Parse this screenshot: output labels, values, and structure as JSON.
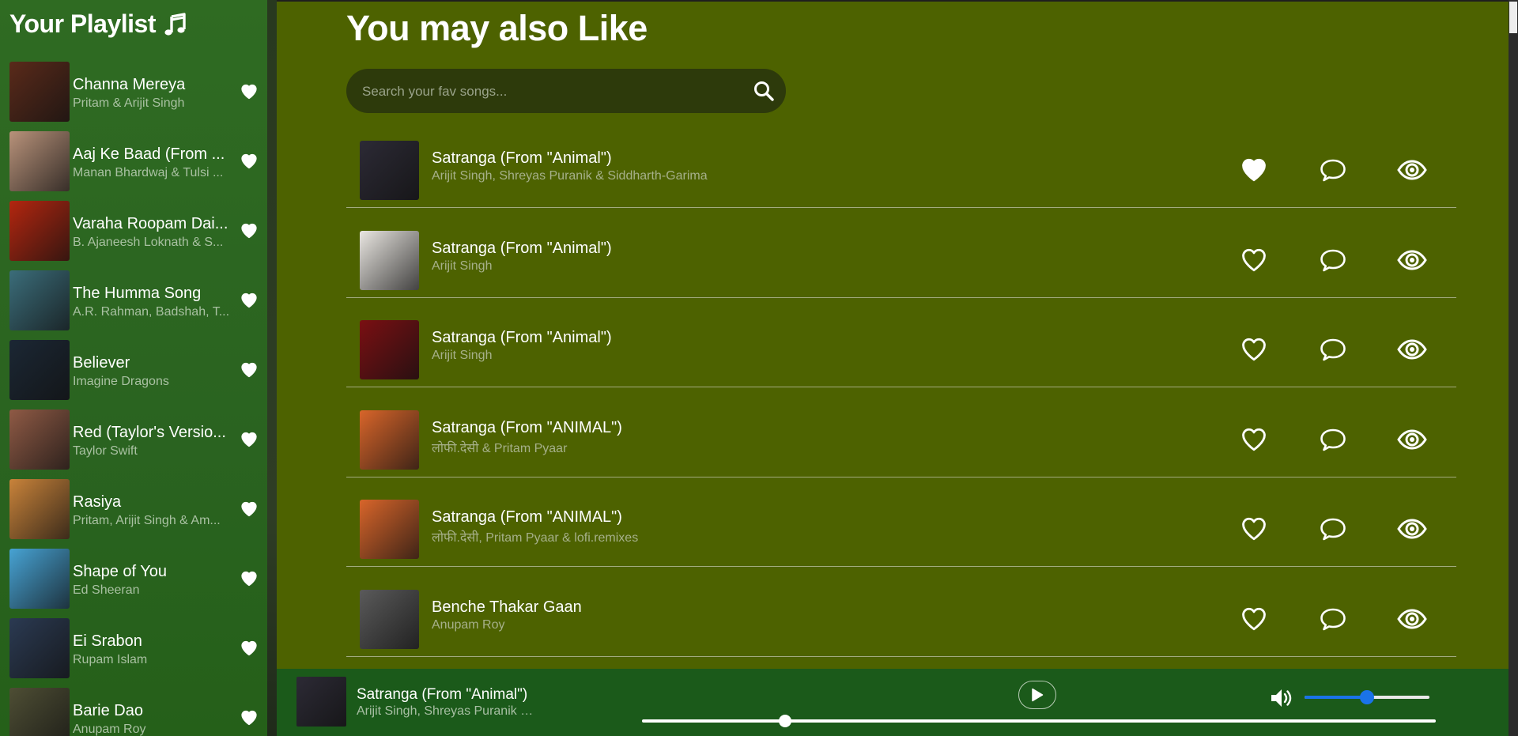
{
  "sidebar": {
    "title": "Your Playlist",
    "title_icon": "music-note-icon",
    "items": [
      {
        "title": "Channa Mereya",
        "artist": "Pritam & Arijit Singh",
        "art": "#5a2a1a"
      },
      {
        "title": "Aaj Ke Baad (From ...",
        "artist": "Manan Bhardwaj & Tulsi ...",
        "art": "#b8927a"
      },
      {
        "title": "Varaha Roopam Dai...",
        "artist": "B. Ajaneesh Loknath & S...",
        "art": "#b3260f"
      },
      {
        "title": "The Humma Song",
        "artist": "A.R. Rahman, Badshah, T...",
        "art": "#3b6d7a"
      },
      {
        "title": "Believer",
        "artist": "Imagine Dragons",
        "art": "#1b2734"
      },
      {
        "title": "Red (Taylor's Versio...",
        "artist": "Taylor Swift",
        "art": "#8f5a45"
      },
      {
        "title": "Rasiya",
        "artist": "Pritam, Arijit Singh & Am...",
        "art": "#c9833a"
      },
      {
        "title": "Shape of You",
        "artist": "Ed Sheeran",
        "art": "#47a3d4"
      },
      {
        "title": "Ei Srabon",
        "artist": "Rupam Islam",
        "art": "#2b3a52"
      },
      {
        "title": "Barie Dao",
        "artist": "Anupam Roy",
        "art": "#4e4e34"
      }
    ]
  },
  "main": {
    "heading": "You may also Like",
    "search": {
      "placeholder": "Search your fav songs...",
      "icon": "search-icon"
    },
    "songs": [
      {
        "title": "Satranga (From \"Animal\")",
        "artist": "Arijit Singh, Shreyas Puranik & Siddharth-Garima",
        "liked": true,
        "art": "#2c2a35"
      },
      {
        "title": "Satranga (From \"Animal\")",
        "artist": "Arijit Singh",
        "liked": false,
        "art": "#e9e6e1"
      },
      {
        "title": "Satranga (From \"Animal\")",
        "artist": "Arijit Singh",
        "liked": false,
        "art": "#7a0f12"
      },
      {
        "title": "Satranga (From \"ANIMAL\")",
        "artist": "लोफी.देसी & Pritam Pyaar",
        "liked": false,
        "art": "#d8652a"
      },
      {
        "title": "Satranga (From \"ANIMAL\")",
        "artist": "लोफी.देसी, Pritam Pyaar & lofi.remixes",
        "liked": false,
        "art": "#d8652a"
      },
      {
        "title": "Benche Thakar Gaan",
        "artist": "Anupam Roy",
        "liked": false,
        "art": "#5a5a5a"
      }
    ],
    "row_icons": {
      "like": "heart-icon",
      "comment": "comment-icon",
      "view": "eye-icon"
    }
  },
  "player": {
    "title": "Satranga (From \"Animal\")",
    "artist": "Arijit Singh, Shreyas Puranik & Siddharth-Garima",
    "play_icon": "play-icon",
    "volume_icon": "volume-icon",
    "seek_fraction": 0.18,
    "volume_fraction": 0.5
  },
  "colors": {
    "sidebar_bg": "#2e6a21",
    "main_bg": "#4d6200",
    "player_bg": "#1b5a1a",
    "accent": "#1a73e8"
  }
}
